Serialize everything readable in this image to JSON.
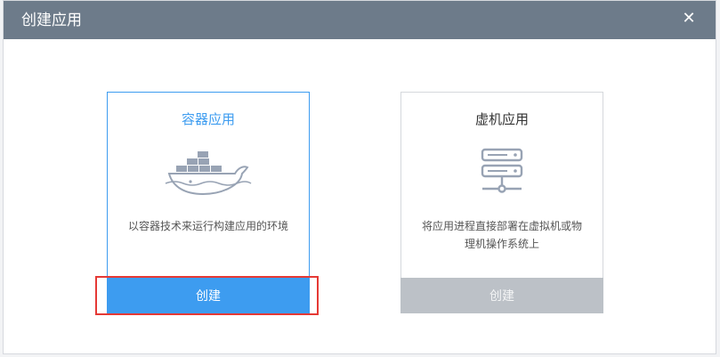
{
  "dialog": {
    "title": "创建应用",
    "close_symbol": "✕"
  },
  "cards": [
    {
      "title": "容器应用",
      "icon": "docker-whale-icon",
      "description": "以容器技术来运行构建应用的环境",
      "button_label": "创建",
      "selected": true
    },
    {
      "title": "虚机应用",
      "icon": "server-icon",
      "description": "将应用进程直接部署在虚拟机或物理机操作系统上",
      "button_label": "创建",
      "selected": false
    }
  ],
  "colors": {
    "titlebar": "#6d7b8a",
    "accent": "#3d9cf0",
    "disabled_button": "#bcc1c7",
    "highlight": "#e53935"
  }
}
